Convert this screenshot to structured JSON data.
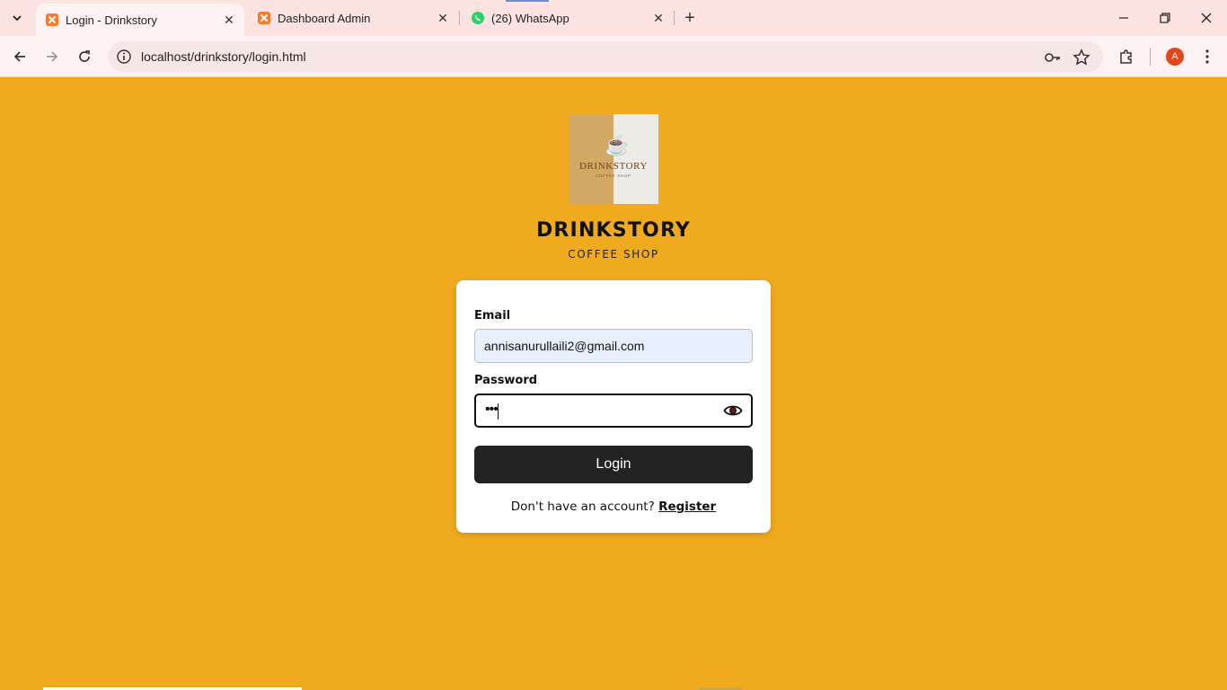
{
  "browser": {
    "tabs": [
      {
        "title": "Login - Drinkstory",
        "active": true,
        "icon": "xampp-icon"
      },
      {
        "title": "Dashboard Admin",
        "active": false,
        "icon": "xampp-icon"
      },
      {
        "title": "(26) WhatsApp",
        "active": false,
        "icon": "whatsapp-icon"
      }
    ],
    "url": "localhost/drinkstory/login.html",
    "profile_initial": "A"
  },
  "page": {
    "logo": {
      "name": "DRINKSTORY",
      "subtitle": "COFFEE SHOP"
    },
    "brand": "DRINKSTORY",
    "tagline": "COFFEE SHOP"
  },
  "form": {
    "email_label": "Email",
    "email_value": "annisanurullaili2@gmail.com",
    "password_label": "Password",
    "password_masked": "•••",
    "login_label": "Login",
    "register_prompt": "Don't have an account?",
    "register_link": "Register"
  },
  "colors": {
    "page_background": "#f0aa1e",
    "button": "#222222",
    "tabbar": "#fde2e2"
  }
}
